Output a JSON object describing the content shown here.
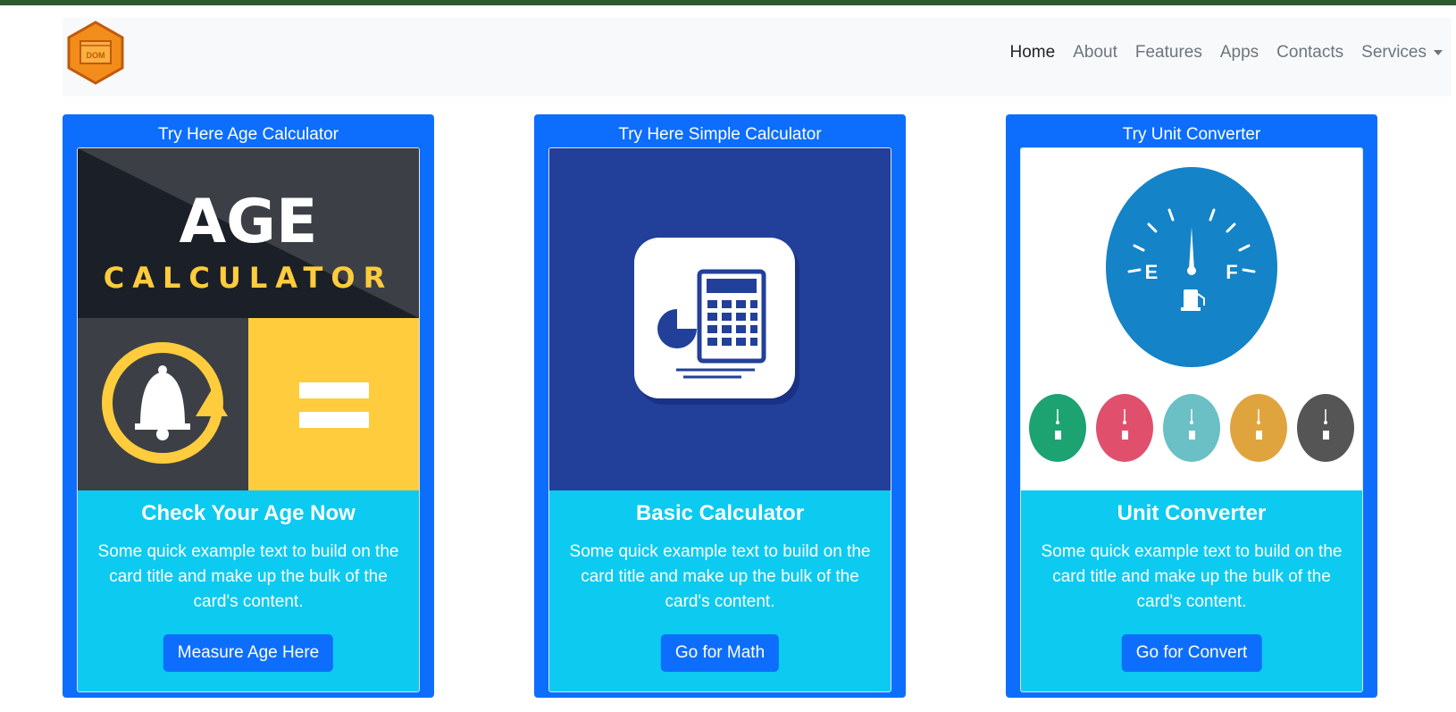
{
  "brand": {
    "logo_text": "DOM"
  },
  "nav": {
    "items": [
      "Home",
      "About",
      "Features",
      "Apps",
      "Contacts"
    ],
    "dropdown_label": "Services"
  },
  "cards": [
    {
      "header": "Try Here Age Calculator",
      "image": {
        "line1": "AGE",
        "line2": "CALCULATOR"
      },
      "title": "Check Your Age Now",
      "text": "Some quick example text to build on the card title and make up the bulk of the card's content.",
      "button": "Measure Age Here"
    },
    {
      "header": "Try Here Simple Calculator",
      "title": "Basic Calculator",
      "text": "Some quick example text to build on the card title and make up the bulk of the card's content.",
      "button": "Go for Math"
    },
    {
      "header": "Try Unit Converter",
      "image": {
        "empty": "E",
        "full": "F"
      },
      "title": "Unit Converter",
      "text": "Some quick example text to build on the card title and make up the bulk of the card's content.",
      "button": "Go for Convert"
    }
  ],
  "colors": {
    "primary": "#0d6efd",
    "info": "#0dcaf0",
    "navbar_bg": "#f8f9fa",
    "logo_orange": "#f28c1b"
  }
}
